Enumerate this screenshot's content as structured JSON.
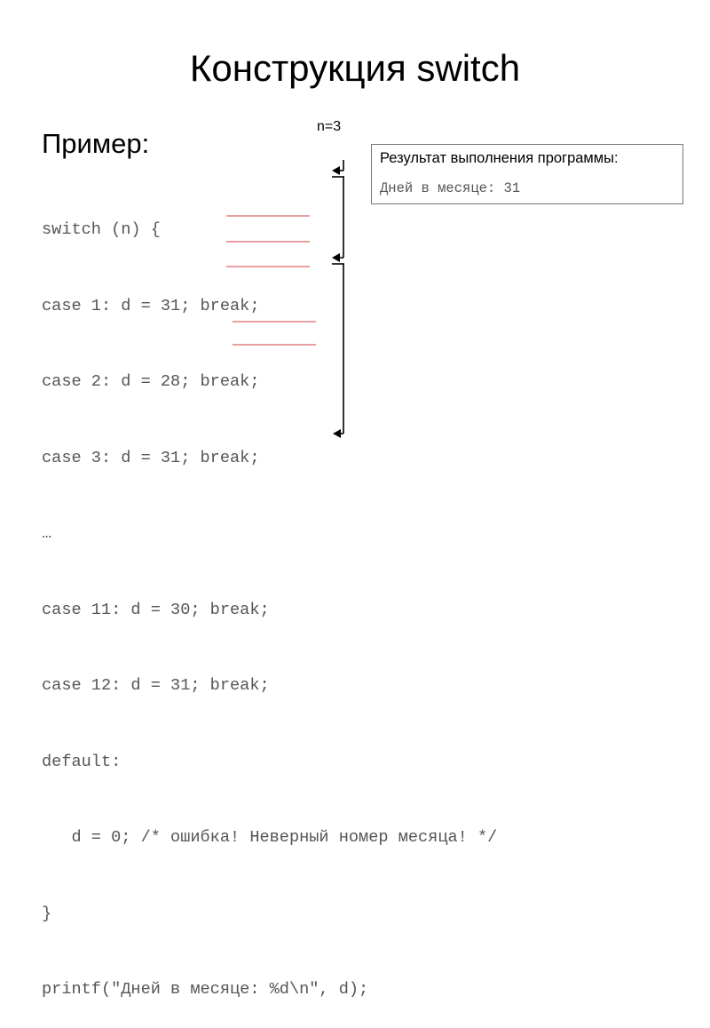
{
  "slide": {
    "title": "Конструкция switch",
    "subheading": "Пример:",
    "variable_label": "n=3",
    "code_lines": [
      "switch (n) {",
      "case 1: d = 31; break;",
      "case 2: d = 28; break;",
      "case 3: d = 31; break;",
      "…",
      "case 11: d = 30; break;",
      "case 12: d = 31; break;",
      "default:",
      "   d = 0; /* ошибка! Неверный номер месяца! */",
      "}",
      "printf(\"Дней в месяце: %d\\n\", d);"
    ],
    "result_box": {
      "title": "Результат выполнения программы:",
      "output": "Дней в месяце: 31"
    },
    "colors": {
      "highlight_underline": "#e8a0a0",
      "code_text": "#555555",
      "arrow": "#000000"
    }
  }
}
